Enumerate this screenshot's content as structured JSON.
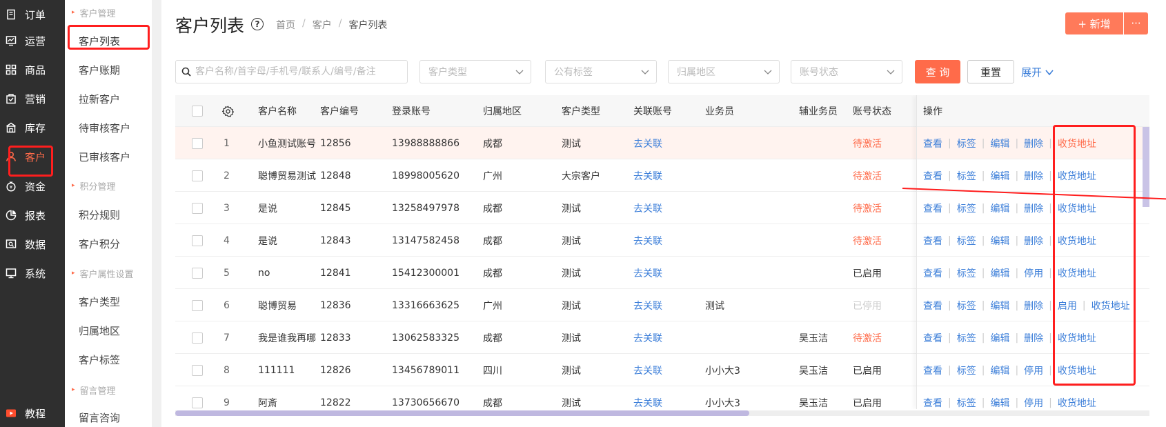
{
  "nav1": [
    {
      "label": "订单",
      "icon": "order-icon"
    },
    {
      "label": "运营",
      "icon": "operation-icon"
    },
    {
      "label": "商品",
      "icon": "product-icon"
    },
    {
      "label": "营销",
      "icon": "marketing-icon"
    },
    {
      "label": "库存",
      "icon": "warehouse-icon"
    },
    {
      "label": "客户",
      "icon": "customer-icon",
      "active": true
    },
    {
      "label": "资金",
      "icon": "money-icon"
    },
    {
      "label": "报表",
      "icon": "report-icon"
    },
    {
      "label": "数据",
      "icon": "data-icon"
    },
    {
      "label": "系统",
      "icon": "system-icon"
    },
    {
      "label": "教程",
      "icon": "tutorial-icon"
    }
  ],
  "nav2": {
    "groups": [
      "客户管理",
      "积分管理",
      "客户属性设置",
      "留言管理"
    ],
    "items": [
      "客户列表",
      "客户账期",
      "拉新客户",
      "待审核客户",
      "已审核客户",
      "积分规则",
      "客户积分",
      "客户类型",
      "归属地区",
      "客户标签",
      "留言咨询"
    ]
  },
  "header": {
    "title": "客户列表",
    "help": "?",
    "breadcrumb": [
      "首页",
      "客户",
      "客户列表"
    ],
    "separator": "/",
    "add_label": "+ 新增",
    "more_label": "···"
  },
  "filters": {
    "search_placeholder": "客户名称/首字母/手机号/联系人/编号/备注",
    "selects": [
      "客户类型",
      "公有标签",
      "归属地区",
      "账号状态"
    ],
    "query_label": "查 询",
    "reset_label": "重置",
    "expand_label": "展开"
  },
  "table": {
    "columns": [
      "客户名称",
      "客户编号",
      "登录账号",
      "归属地区",
      "客户类型",
      "关联账号",
      "业务员",
      "辅业务员",
      "账号状态",
      "操作"
    ],
    "link_text": "去关联",
    "rows": [
      {
        "idx": "1",
        "name": "小鱼测试账号",
        "code": "12856",
        "login": "13988888866",
        "region": "成都",
        "type": "测试",
        "salesman": "",
        "assistant": "",
        "status": "待激活",
        "status_kind": "pending",
        "ops": [
          "查看",
          "标签",
          "编辑",
          "删除",
          "收货地址"
        ]
      },
      {
        "idx": "2",
        "name": "聪博贸易测试",
        "code": "12848",
        "login": "18998005620",
        "region": "广州",
        "type": "大宗客户",
        "salesman": "",
        "assistant": "",
        "status": "待激活",
        "status_kind": "pending",
        "ops": [
          "查看",
          "标签",
          "编辑",
          "删除",
          "收货地址"
        ]
      },
      {
        "idx": "3",
        "name": "是说",
        "code": "12845",
        "login": "13258497978",
        "region": "成都",
        "type": "测试",
        "salesman": "",
        "assistant": "",
        "status": "待激活",
        "status_kind": "pending",
        "ops": [
          "查看",
          "标签",
          "编辑",
          "删除",
          "收货地址"
        ]
      },
      {
        "idx": "4",
        "name": "是说",
        "code": "12843",
        "login": "13147582458",
        "region": "成都",
        "type": "测试",
        "salesman": "",
        "assistant": "",
        "status": "待激活",
        "status_kind": "pending",
        "ops": [
          "查看",
          "标签",
          "编辑",
          "删除",
          "收货地址"
        ]
      },
      {
        "idx": "5",
        "name": "no",
        "code": "12841",
        "login": "15412300001",
        "region": "成都",
        "type": "测试",
        "salesman": "",
        "assistant": "",
        "status": "已启用",
        "status_kind": "active",
        "ops": [
          "查看",
          "标签",
          "编辑",
          "停用",
          "收货地址"
        ]
      },
      {
        "idx": "6",
        "name": "聪博贸易",
        "code": "12836",
        "login": "13316663625",
        "region": "广州",
        "type": "测试",
        "salesman": "测试",
        "assistant": "",
        "status": "已停用",
        "status_kind": "stopped",
        "ops": [
          "查看",
          "标签",
          "编辑",
          "删除",
          "启用",
          "收货地址"
        ]
      },
      {
        "idx": "7",
        "name": "我是谁我再哪",
        "code": "12833",
        "login": "13062583325",
        "region": "成都",
        "type": "测试",
        "salesman": "",
        "assistant": "吴玉洁",
        "status": "待激活",
        "status_kind": "pending",
        "ops": [
          "查看",
          "标签",
          "编辑",
          "删除",
          "收货地址"
        ]
      },
      {
        "idx": "8",
        "name": "111111",
        "code": "12826",
        "login": "13456789011",
        "region": "四川",
        "type": "测试",
        "salesman": "小小大3",
        "assistant": "吴玉洁",
        "status": "已启用",
        "status_kind": "active",
        "ops": [
          "查看",
          "标签",
          "编辑",
          "停用",
          "收货地址"
        ]
      },
      {
        "idx": "9",
        "name": "阿斎",
        "code": "12822",
        "login": "13730656670",
        "region": "成都",
        "type": "测试",
        "salesman": "小小大3",
        "assistant": "吴玉洁",
        "status": "已启用",
        "status_kind": "active",
        "ops": [
          "查看",
          "标签",
          "编辑",
          "停用",
          "收货地址"
        ]
      }
    ]
  },
  "colors": {
    "accent": "#ff6b4a",
    "link": "#3d7fd9",
    "annotation": "#ff1e1e"
  }
}
